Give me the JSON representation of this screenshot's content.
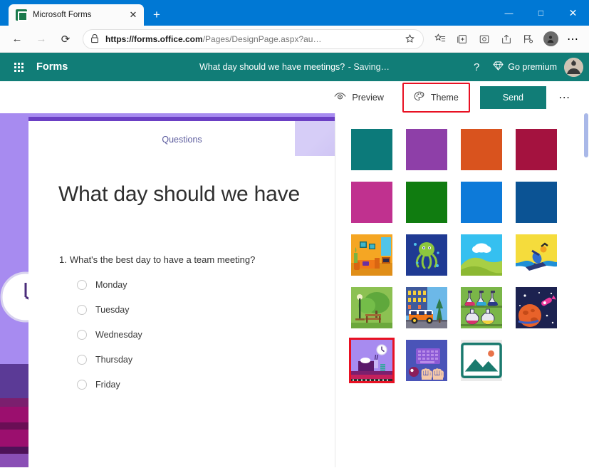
{
  "browser": {
    "tab": {
      "title": "Microsoft Forms",
      "favicon": "forms-favicon",
      "close_label": "✕"
    },
    "new_tab_label": "+",
    "window_controls": {
      "minimize": "—",
      "maximize": "□",
      "close": "✕"
    },
    "nav": {
      "back": "←",
      "forward": "→",
      "reload": "⟳"
    },
    "url": {
      "scheme_host": "https://forms.office.com",
      "path": "/Pages/DesignPage.aspx?au…",
      "lock": "lock-icon"
    },
    "toolbar_icons": [
      "favorites-icon",
      "collections-icon",
      "immersive-reader-icon",
      "share-icon",
      "pin-icon",
      "profile-icon",
      "settings-more-icon"
    ],
    "more_label": "⋯"
  },
  "app_header": {
    "waffle": "app-launcher-icon",
    "brand": "Forms",
    "form_title": "What day should we have meetings?",
    "status": "- Saving…",
    "help": "?",
    "premium_label": "Go premium",
    "premium_icon": "diamond-icon",
    "avatar": "user-avatar"
  },
  "command_bar": {
    "preview_label": "Preview",
    "preview_icon": "eye-icon",
    "theme_label": "Theme",
    "theme_icon": "palette-icon",
    "send_label": "Send",
    "more_label": "⋯",
    "highlight_color": "#e81123"
  },
  "form": {
    "tab_label": "Questions",
    "title": "What day should we have",
    "questions": [
      {
        "number": "1.",
        "text": "What's the best day to have a team meeting?",
        "options": [
          "Monday",
          "Tuesday",
          "Wednesday",
          "Thursday",
          "Friday"
        ]
      }
    ],
    "accent_bar_color": "#6b3fc4"
  },
  "theme_panel": {
    "selected_index": 16,
    "themes": [
      {
        "name": "teal",
        "kind": "color",
        "color": "#0c7a7a"
      },
      {
        "name": "purple",
        "kind": "color",
        "color": "#8e3fa8"
      },
      {
        "name": "orange",
        "kind": "color",
        "color": "#d9531e"
      },
      {
        "name": "crimson",
        "kind": "color",
        "color": "#a4123f"
      },
      {
        "name": "magenta",
        "kind": "color",
        "color": "#c0318f"
      },
      {
        "name": "green",
        "kind": "color",
        "color": "#107c10"
      },
      {
        "name": "blue",
        "kind": "color",
        "color": "#0d7ad9"
      },
      {
        "name": "dark-blue",
        "kind": "color",
        "color": "#0b5394"
      },
      {
        "name": "living-room",
        "kind": "image",
        "color": "#f0a020"
      },
      {
        "name": "octopus",
        "kind": "image",
        "color": "#1f3a93"
      },
      {
        "name": "landscape-cloud",
        "kind": "image",
        "color": "#29b6ec"
      },
      {
        "name": "snowboarder",
        "kind": "image",
        "color": "#f2d332"
      },
      {
        "name": "park-bench",
        "kind": "image",
        "color": "#84c04a"
      },
      {
        "name": "school-bus",
        "kind": "image",
        "color": "#5aa9e0"
      },
      {
        "name": "science-flasks",
        "kind": "image",
        "color": "#6cb33f"
      },
      {
        "name": "space-planet",
        "kind": "image",
        "color": "#1c2250"
      },
      {
        "name": "office-desk",
        "kind": "image",
        "color": "#a78bf0"
      },
      {
        "name": "keyboard-hands",
        "kind": "image",
        "color": "#4a54b8"
      },
      {
        "name": "custom-image",
        "kind": "custom",
        "color": "#ebebeb",
        "icon": "picture-icon"
      }
    ]
  }
}
